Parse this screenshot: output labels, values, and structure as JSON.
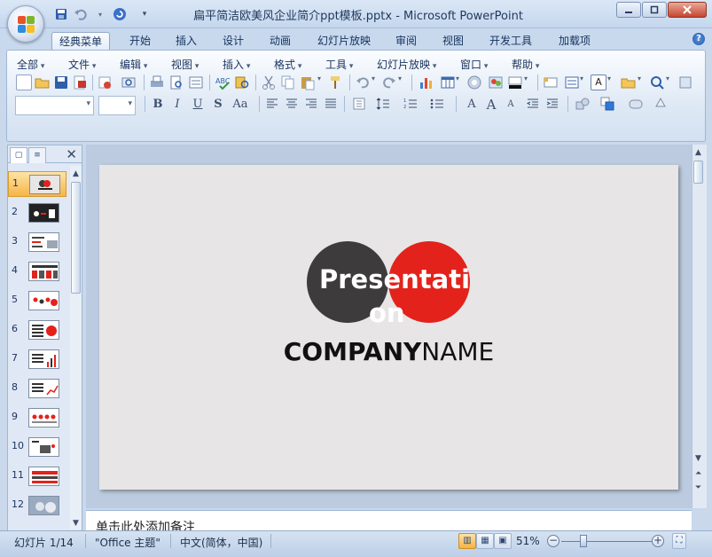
{
  "window": {
    "title": "扁平简洁欧美风企业简介ppt模板.pptx - Microsoft PowerPoint",
    "controls": [
      "minimize-icon",
      "restore-icon",
      "close-icon"
    ]
  },
  "quick_access": [
    "save-icon",
    "undo-icon",
    "redo-icon",
    "customize-icon"
  ],
  "tabs": [
    {
      "label": "经典菜单",
      "active": true
    },
    {
      "label": "开始"
    },
    {
      "label": "插入"
    },
    {
      "label": "设计"
    },
    {
      "label": "动画"
    },
    {
      "label": "幻灯片放映"
    },
    {
      "label": "审阅"
    },
    {
      "label": "视图"
    },
    {
      "label": "开发工具"
    },
    {
      "label": "加载项"
    }
  ],
  "menu": [
    "全部",
    "文件",
    "编辑",
    "视图",
    "插入",
    "格式",
    "工具",
    "幻灯片放映",
    "窗口",
    "帮助"
  ],
  "format_buttons": [
    "B",
    "I",
    "U",
    "S",
    "Aa"
  ],
  "slides_pane": {
    "tab_icons": [
      "slides-tab-icon",
      "outline-tab-icon"
    ],
    "close": "✕",
    "thumbnails": [
      "1",
      "2",
      "3",
      "4",
      "5",
      "6",
      "7",
      "8",
      "9",
      "10",
      "11",
      "12"
    ],
    "active_index": 0
  },
  "slide": {
    "title_word": "Presentation",
    "title_line1": "Presentati",
    "title_line2": "on",
    "company_bold": "COMPANY",
    "company_light": "NAME",
    "colors": {
      "dark_circle": "#3d3b3c",
      "red_circle": "#e3221b",
      "background": "#e7e5e6"
    }
  },
  "notes": {
    "placeholder": "单击此处添加备注"
  },
  "status_bar": {
    "slide_info": "幻灯片 1/14",
    "theme": "\"Office 主题\"",
    "language": "中文(简体，中国)",
    "zoom": "51%",
    "zoom_value": 51
  },
  "colors": {
    "ribbon_bg": "#dfe9f5",
    "accent_orange": "#f7b545",
    "title_text": "#1e395b"
  }
}
